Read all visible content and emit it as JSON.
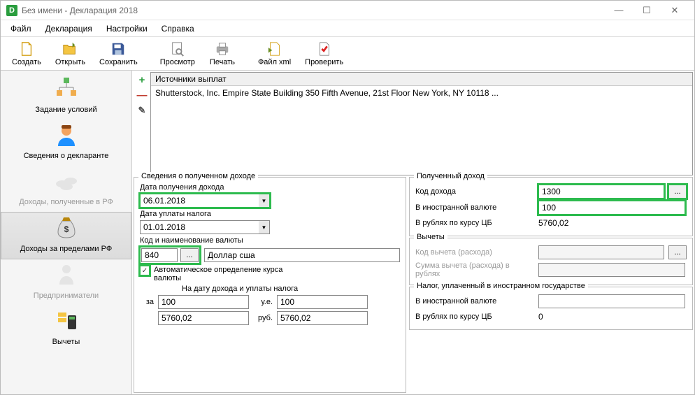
{
  "window": {
    "title": "Без имени - Декларация 2018"
  },
  "menu": {
    "file": "Файл",
    "declaration": "Декларация",
    "settings": "Настройки",
    "help": "Справка"
  },
  "toolbar": {
    "create": "Создать",
    "open": "Открыть",
    "save": "Сохранить",
    "preview": "Просмотр",
    "print": "Печать",
    "xml": "Файл xml",
    "check": "Проверить"
  },
  "sidebar": {
    "conditions": "Задание условий",
    "declarant": "Сведения о декларанте",
    "income_rf": "Доходы, полученные в РФ",
    "income_foreign": "Доходы за пределами РФ",
    "entrepreneurs": "Предприниматели",
    "deductions": "Вычеты"
  },
  "sources": {
    "header": "Источники выплат",
    "item0": "Shutterstock, Inc. Empire State Building 350 Fifth Avenue, 21st Floor New York, NY 10118 ..."
  },
  "income_info": {
    "group_title": "Сведения о полученном доходе",
    "date_received_lbl": "Дата получения дохода",
    "date_received": "06.01.2018",
    "date_tax_lbl": "Дата уплаты налога",
    "date_tax": "01.01.2018",
    "currency_lbl": "Код и наименование валюты",
    "currency_code": "840",
    "currency_name": "Доллар сша",
    "auto_rate_lbl": "Автоматическое определение курса валюты",
    "rate_dates_lbl": "На дату дохода и уплаты налога",
    "za": "за",
    "ue": "у.е.",
    "rub": "руб.",
    "amt1": "100",
    "ue1": "100",
    "rub1": "5760,02",
    "rub2": "5760,02"
  },
  "received": {
    "group_title": "Полученный доход",
    "code_lbl": "Код дохода",
    "code": "1300",
    "foreign_lbl": "В иностранной валюте",
    "foreign": "100",
    "rub_lbl": "В рублях по курсу ЦБ",
    "rub": "5760,02"
  },
  "deductions": {
    "group_title": "Вычеты",
    "code_lbl": "Код вычета (расхода)",
    "sum_lbl": "Сумма вычета (расхода) в рублях"
  },
  "foreign_tax": {
    "group_title": "Налог, уплаченный в иностранном государстве",
    "foreign_lbl": "В иностранной валюте",
    "foreign": "",
    "rub_lbl": "В рублях по курсу ЦБ",
    "rub": "0"
  },
  "ellipsis": "..."
}
